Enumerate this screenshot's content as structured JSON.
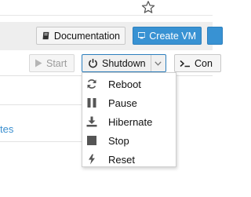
{
  "header": {
    "documentation_label": "Documentation",
    "create_vm_label": "Create VM"
  },
  "toolbar": {
    "start_label": "Start",
    "shutdown_label": "Shutdown",
    "console_label": "Con"
  },
  "shutdown_menu": {
    "items": [
      {
        "label": "Reboot",
        "icon": "refresh-icon"
      },
      {
        "label": "Pause",
        "icon": "pause-icon"
      },
      {
        "label": "Hibernate",
        "icon": "download-icon"
      },
      {
        "label": "Stop",
        "icon": "stop-icon"
      },
      {
        "label": "Reset",
        "icon": "bolt-icon"
      }
    ]
  },
  "nav": {
    "partial_link": "tes"
  },
  "colors": {
    "accent": "#3892d3",
    "link": "#3b8fcf"
  }
}
